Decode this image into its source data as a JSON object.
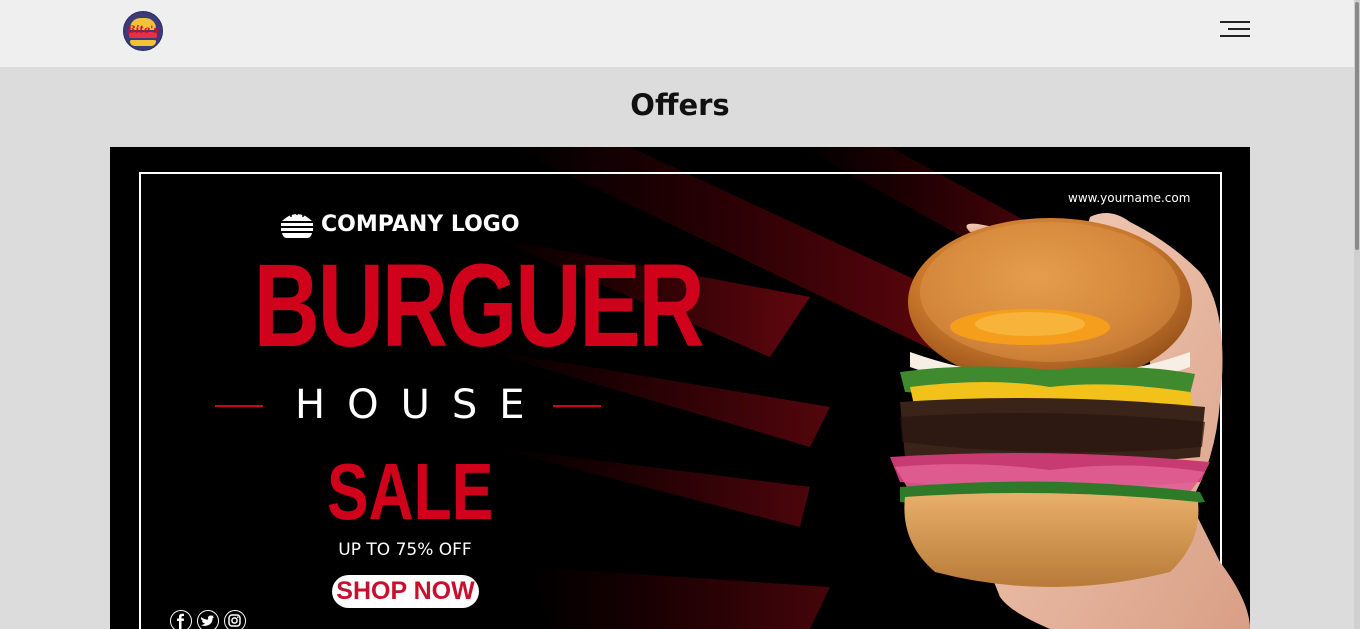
{
  "navbar": {
    "logo_text": "Bite's",
    "menu_icon": "hamburger-menu-icon"
  },
  "page": {
    "title": "Offers"
  },
  "banner": {
    "website": "www.yourname.com",
    "company_logo_text": "COMPANY LOGO",
    "headline": "BURGUER",
    "subheadline": "HOUSE",
    "sale_text": "SALE",
    "discount_text": "UP TO 75% OFF",
    "cta_label": "SHOP NOW",
    "social_icons": [
      "facebook-icon",
      "twitter-icon",
      "instagram-icon"
    ],
    "colors": {
      "accent": "#d0021b",
      "background": "#000000",
      "text": "#ffffff"
    }
  }
}
